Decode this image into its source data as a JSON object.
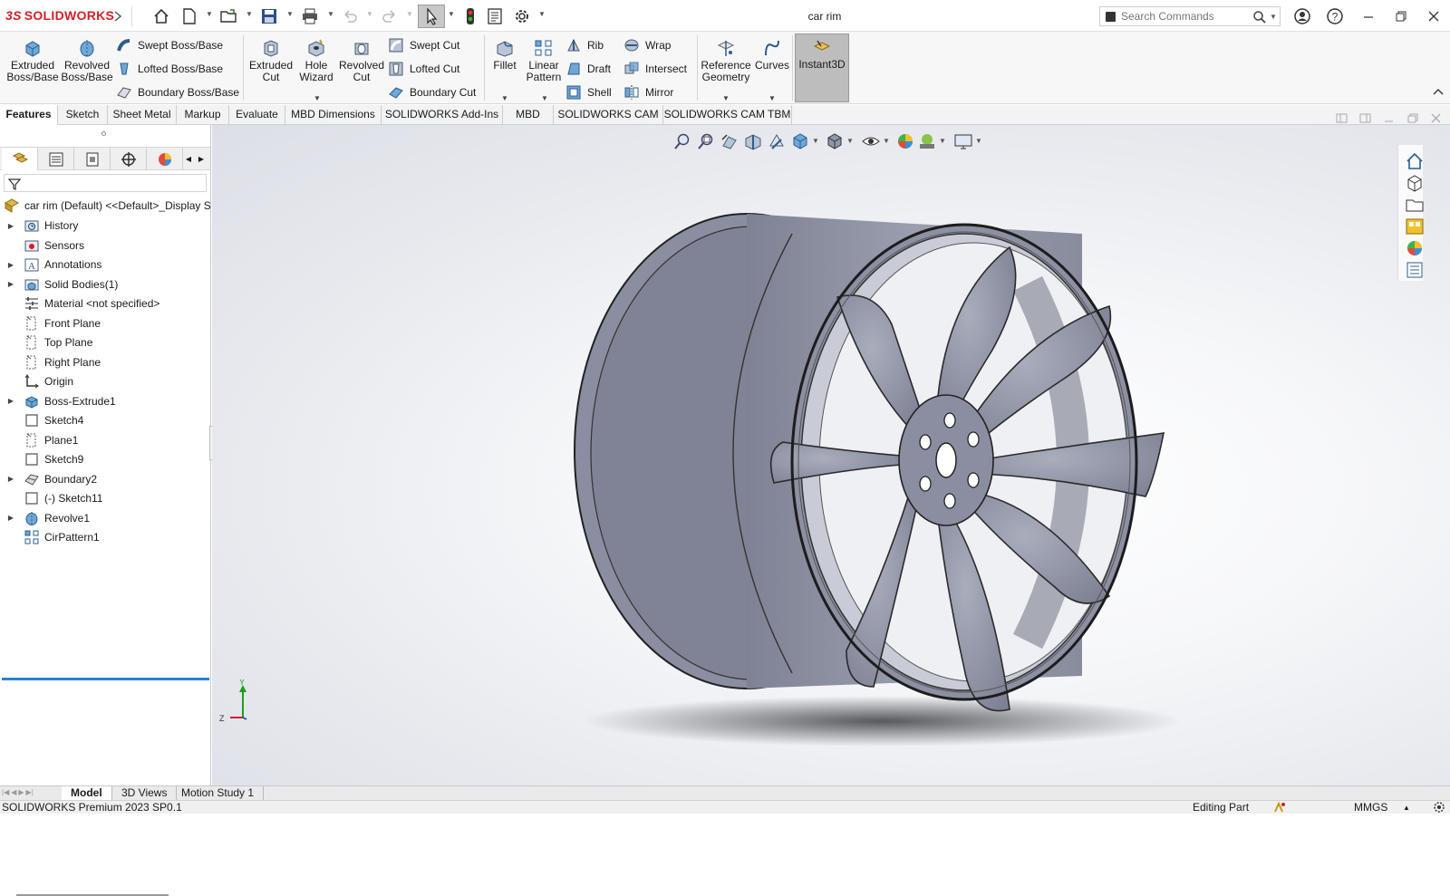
{
  "app": {
    "brand": "SOLIDWORKS",
    "brand_prefix": "3S",
    "document_title": "car rim"
  },
  "search": {
    "placeholder": "Search Commands"
  },
  "toolbar": {
    "extruded_boss": "Extruded\nBoss/Base",
    "revolved_boss": "Revolved\nBoss/Base",
    "swept_boss": "Swept Boss/Base",
    "lofted_boss": "Lofted Boss/Base",
    "boundary_boss": "Boundary Boss/Base",
    "extruded_cut": "Extruded\nCut",
    "hole_wizard": "Hole\nWizard",
    "revolved_cut": "Revolved\nCut",
    "swept_cut": "Swept Cut",
    "lofted_cut": "Lofted Cut",
    "boundary_cut": "Boundary Cut",
    "fillet": "Fillet",
    "linear_pattern": "Linear\nPattern",
    "rib": "Rib",
    "draft": "Draft",
    "shell": "Shell",
    "wrap": "Wrap",
    "intersect": "Intersect",
    "mirror": "Mirror",
    "reference_geometry": "Reference\nGeometry",
    "curves": "Curves",
    "instant3d": "Instant3D"
  },
  "tabs": [
    "Features",
    "Sketch",
    "Sheet Metal",
    "Markup",
    "Evaluate",
    "MBD Dimensions",
    "SOLIDWORKS Add-Ins",
    "MBD",
    "SOLIDWORKS CAM",
    "SOLIDWORKS CAM TBM"
  ],
  "tree": {
    "root": "car rim (Default) <<Default>_Display S",
    "items": [
      {
        "label": "History",
        "expandable": true,
        "icon": "history-folder-icon"
      },
      {
        "label": "Sensors",
        "expandable": false,
        "icon": "sensors-icon"
      },
      {
        "label": "Annotations",
        "expandable": true,
        "icon": "annotations-icon"
      },
      {
        "label": "Solid Bodies(1)",
        "expandable": true,
        "icon": "solid-bodies-icon"
      },
      {
        "label": "Material <not specified>",
        "expandable": false,
        "icon": "material-icon"
      },
      {
        "label": "Front Plane",
        "expandable": false,
        "icon": "plane-icon"
      },
      {
        "label": "Top Plane",
        "expandable": false,
        "icon": "plane-icon"
      },
      {
        "label": "Right Plane",
        "expandable": false,
        "icon": "plane-icon"
      },
      {
        "label": "Origin",
        "expandable": false,
        "icon": "origin-icon"
      },
      {
        "label": "Boss-Extrude1",
        "expandable": true,
        "icon": "boss-extrude-icon"
      },
      {
        "label": "Sketch4",
        "expandable": false,
        "icon": "sketch-icon"
      },
      {
        "label": "Plane1",
        "expandable": false,
        "icon": "plane-icon"
      },
      {
        "label": "Sketch9",
        "expandable": false,
        "icon": "sketch-icon"
      },
      {
        "label": "Boundary2",
        "expandable": true,
        "icon": "boundary-icon"
      },
      {
        "label": "(-) Sketch11",
        "expandable": false,
        "icon": "sketch-icon"
      },
      {
        "label": "Revolve1",
        "expandable": true,
        "icon": "revolve-icon"
      },
      {
        "label": "CirPattern1",
        "expandable": false,
        "icon": "circular-pattern-icon"
      }
    ]
  },
  "triad": {
    "y": "Y",
    "z": "Z"
  },
  "bottom_tabs": [
    "Model",
    "3D Views",
    "Motion Study 1"
  ],
  "status": {
    "version": "SOLIDWORKS Premium 2023 SP0.1",
    "mode": "Editing Part",
    "units": "MMGS"
  },
  "colors": {
    "accent_red": "#d31f26",
    "model_gray": "#8e92a3",
    "selection_blue": "#2f7fd0"
  }
}
